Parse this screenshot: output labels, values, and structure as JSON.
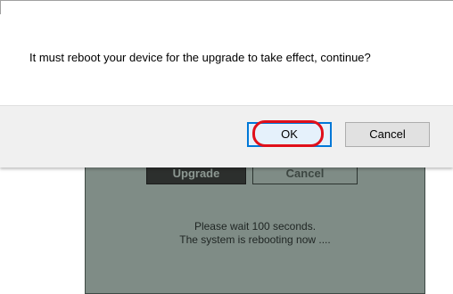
{
  "background": {
    "buttons": {
      "upgrade_label": "Upgrade",
      "cancel_label": "Cancel"
    },
    "message_line1": "Please wait 100 seconds.",
    "message_line2": "The system is rebooting now ...."
  },
  "dialog": {
    "message": "It must reboot your device for the upgrade to take effect, continue?",
    "ok_label": "OK",
    "cancel_label": "Cancel"
  },
  "colors": {
    "panel": "#7f8c86",
    "focus_border": "#0078d7",
    "highlight": "#e0101a",
    "footer": "#f0f0f0"
  }
}
